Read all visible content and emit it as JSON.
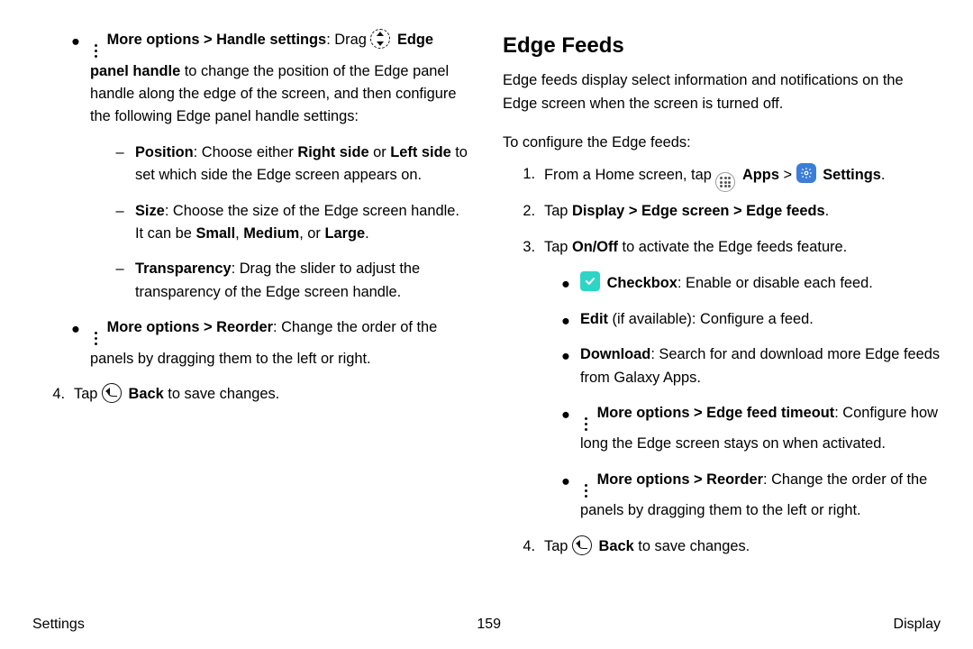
{
  "left": {
    "bullets": [
      {
        "pre_icon": "more",
        "lead_bold": "More options > Handle settings",
        "lead_tail": ": Drag ",
        "inline_icon": "handle",
        "post_bold": "Edge panel handle",
        "post_tail": " to change the position of the Edge panel handle along the edge of the screen, and then configure the following Edge panel handle settings:",
        "subitems": [
          {
            "name": "Position",
            "text_a": ": Choose either ",
            "b1": "Right side",
            "mid": " or ",
            "b2": "Left side",
            "tail": " to set which side the Edge screen appears on."
          },
          {
            "name": "Size",
            "text_a": ": Choose the size of the Edge screen handle. It can be ",
            "b1": "Small",
            "mid": ", ",
            "b2": "Medium",
            "mid2": ", or ",
            "b3": "Large",
            "tail": "."
          },
          {
            "name": "Transparency",
            "text_a": ": Drag the slider to adjust the transparency of the Edge screen handle."
          }
        ]
      },
      {
        "pre_icon": "more",
        "lead_bold": "More options > Reorder",
        "lead_tail": ": Change the order of the panels by dragging them to the left or right."
      }
    ],
    "step4": {
      "num": "4.",
      "a": "Tap ",
      "icon": "back",
      "b": "Back",
      "c": " to save changes."
    }
  },
  "right": {
    "heading": "Edge Feeds",
    "intro": "Edge feeds display select information and notifications on the Edge screen when the screen is turned off.",
    "lead": "To configure the Edge feeds:",
    "s1": {
      "num": "1.",
      "a": "From a Home screen, tap ",
      "apps": "Apps",
      "gt": " > ",
      "settings": "Settings",
      "dot": "."
    },
    "s2": {
      "num": "2.",
      "a": "Tap ",
      "path": "Display > Edge screen > Edge feeds",
      "dot": "."
    },
    "s3": {
      "num": "3.",
      "a": "Tap ",
      "b": "On/Off",
      "c": " to activate the Edge feeds feature."
    },
    "s3bul": [
      {
        "icon": "check",
        "b": "Checkbox",
        "t": ": Enable or disable each feed."
      },
      {
        "b": "Edit",
        "mid": " (if available)",
        "t": ": Configure a feed."
      },
      {
        "b": "Download",
        "t": ": Search for and download more Edge feeds from Galaxy Apps."
      },
      {
        "icon": "more",
        "b": "More options > Edge feed timeout",
        "t": ": Configure how long the Edge screen stays on when activated."
      },
      {
        "icon": "more",
        "b": "More options > Reorder",
        "t": ": Change the order of the panels by dragging them to the left or right."
      }
    ],
    "s4": {
      "num": "4.",
      "a": "Tap ",
      "icon": "back",
      "b": "Back",
      "c": " to save changes."
    }
  },
  "footer": {
    "left": "Settings",
    "center": "159",
    "right": "Display"
  }
}
